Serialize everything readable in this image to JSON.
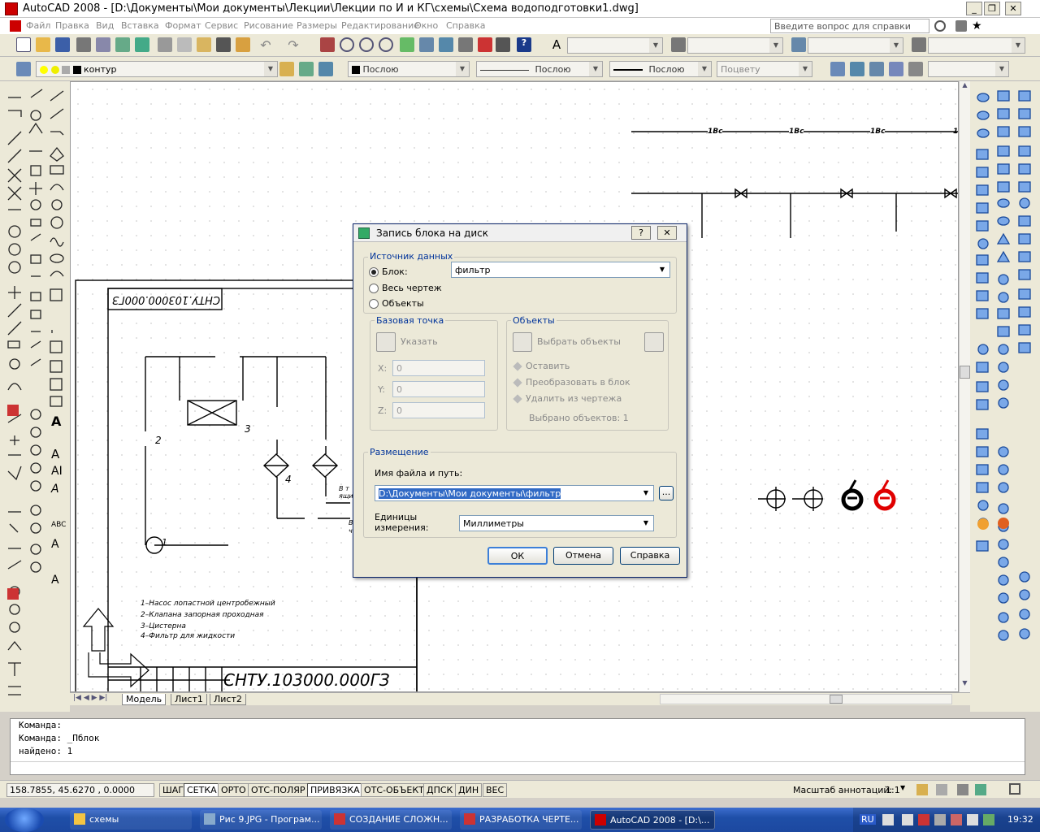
{
  "window": {
    "title": "AutoCAD 2008 - [D:\\Документы\\Мои документы\\Лекции\\Лекции по И и КГ\\схемы\\Схема водоподготовки1.dwg]"
  },
  "menu": {
    "items": [
      "Файл",
      "Правка",
      "Вид",
      "Вставка",
      "Формат",
      "Сервис",
      "Рисование",
      "Размеры",
      "Редактирование",
      "Окно",
      "Справка"
    ],
    "help_placeholder": "Введите вопрос для справки"
  },
  "properties_bar": {
    "layer": "контур",
    "color": "Послою",
    "linetype": "Послою",
    "lineweight": "Послою",
    "plotstyle": "Поцвету"
  },
  "drawing": {
    "title_stamp": "СНТУ.103000.000ГЗ",
    "title_stamp_rotated": "СНТУ.103000.000ГЗ",
    "pipe_labels": [
      "1Вс",
      "1Вс",
      "1Вс",
      "1"
    ],
    "numbers": [
      "1",
      "2",
      "3",
      "4"
    ],
    "legend": [
      "1–Насос лопастной центробежный",
      "2–Клапана запорная проходная",
      "3–Цистерна",
      "4–Фильтр для жидкости"
    ],
    "notes": [
      "В т",
      "ящи",
      "В",
      "ч"
    ]
  },
  "tabs": [
    "Модель",
    "Лист1",
    "Лист2"
  ],
  "command_lines": [
    "Команда:",
    "Команда: _Пблок",
    "найдено: 1"
  ],
  "status": {
    "coords": "158.7855, 45.6270 , 0.0000",
    "toggles": [
      {
        "label": "ШАГ",
        "on": false
      },
      {
        "label": "СЕТКА",
        "on": true
      },
      {
        "label": "ОРТО",
        "on": false
      },
      {
        "label": "ОТС-ПОЛЯР",
        "on": false
      },
      {
        "label": "ПРИВЯЗКА",
        "on": true
      },
      {
        "label": "ОТС-ОБЪЕКТ",
        "on": false
      },
      {
        "label": "ДПСК",
        "on": false
      },
      {
        "label": "ДИН",
        "on": false
      },
      {
        "label": "ВЕС",
        "on": false
      }
    ],
    "annotation_scale_label": "Масштаб аннотаций:",
    "annotation_scale_value": "1:1"
  },
  "dialog": {
    "title": "Запись блока на диск",
    "help_btn": "?",
    "close_btn": "✕",
    "source_group": "Источник данных",
    "source_options": [
      "Блок:",
      "Весь чертеж",
      "Объекты"
    ],
    "block_value": "фильтр",
    "base_point_group": "Базовая точка",
    "pick_point": "Указать",
    "x_label": "X:",
    "y_label": "Y:",
    "z_label": "Z:",
    "x_value": "0",
    "y_value": "0",
    "z_value": "0",
    "objects_group": "Объекты",
    "select_objects": "Выбрать объекты",
    "object_options": [
      "Оставить",
      "Преобразовать в блок",
      "Удалить из чертежа"
    ],
    "selected_count": "Выбрано объектов: 1",
    "placement_group": "Размещение",
    "filename_label": "Имя файла и путь:",
    "filename_value": "D:\\Документы\\Мои документы\\фильтр",
    "browse": "...",
    "units_label_1": "Единицы",
    "units_label_2": "измерения:",
    "units_value": "Миллиметры",
    "ok": "ОК",
    "cancel": "Отмена",
    "help": "Справка"
  },
  "taskbar": {
    "tasks": [
      {
        "label": "схемы",
        "active": false
      },
      {
        "label": "Рис 9.JPG - Програм...",
        "active": false
      },
      {
        "label": "СОЗДАНИЕ СЛОЖН...",
        "active": false
      },
      {
        "label": "РАЗРАБОТКА ЧЕРТЕ...",
        "active": false
      },
      {
        "label": "AutoCAD 2008 - [D:\\...",
        "active": true
      }
    ],
    "lang": "RU",
    "clock": "19:32"
  },
  "colors": {
    "dialog_group_label": "#00339a",
    "red_symbol": "#e00000",
    "taskbar": "#1f4fa8"
  }
}
